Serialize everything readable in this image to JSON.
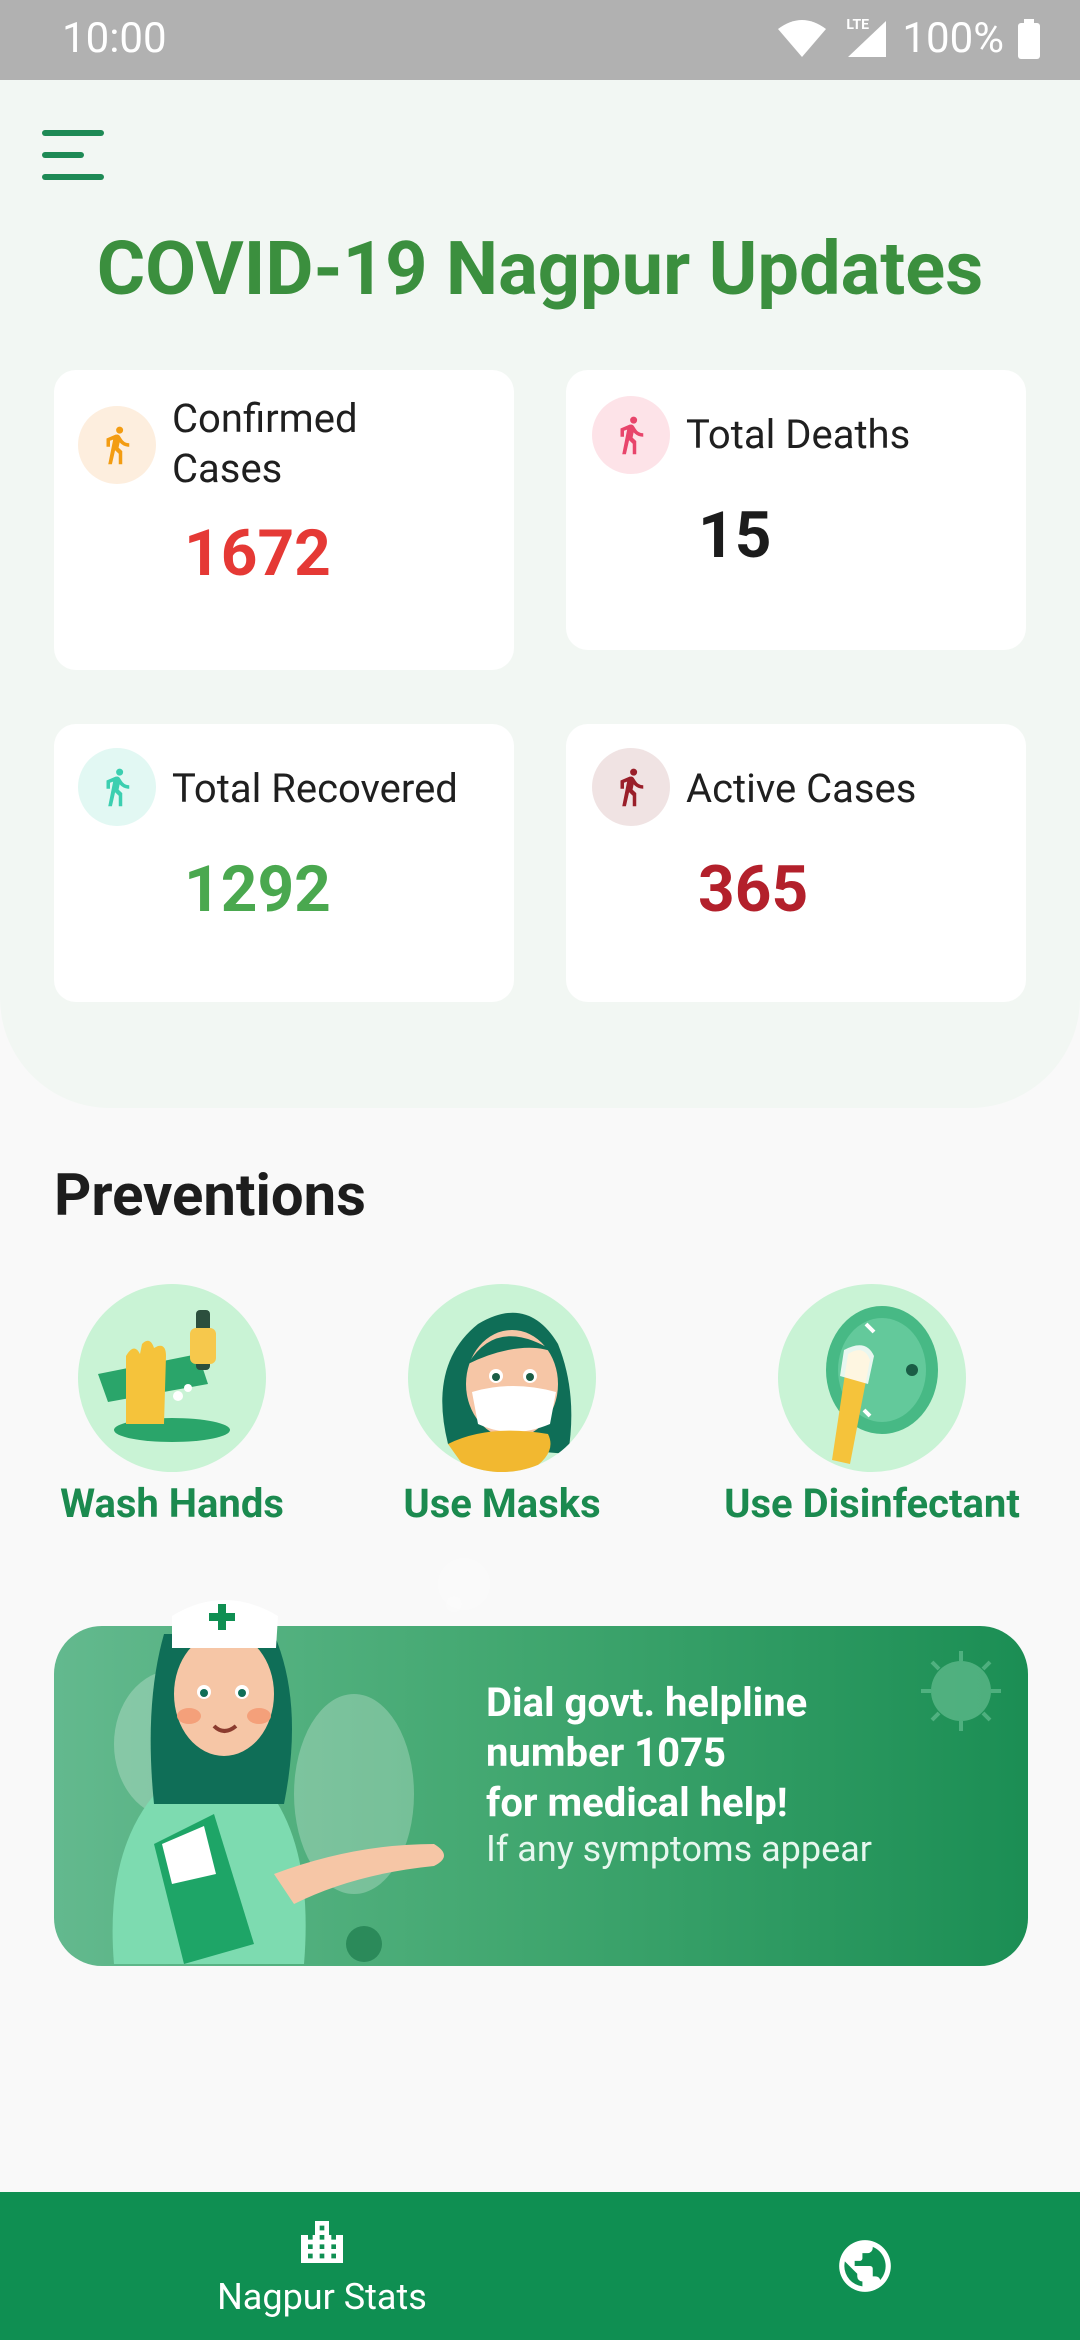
{
  "status_bar": {
    "time": "10:00",
    "network": "LTE",
    "battery": "100%"
  },
  "header": {
    "title": "COVID-19 Nagpur Updates"
  },
  "stats": [
    {
      "label": "Confirmed Cases",
      "value": "1672",
      "color": "#e53935",
      "icon": "running-person-icon",
      "icon_bg": "#fdeede",
      "icon_color": "#f39c12"
    },
    {
      "label": "Total Deaths",
      "value": "15",
      "color": "#1c1c1c",
      "icon": "running-person-icon",
      "icon_bg": "#fde3e8",
      "icon_color": "#e8456b"
    },
    {
      "label": "Total Recovered",
      "value": "1292",
      "color": "#4aa84f",
      "icon": "running-person-icon",
      "icon_bg": "#e2f8f3",
      "icon_color": "#3ccfb0"
    },
    {
      "label": "Active Cases",
      "value": "365",
      "color": "#b3202b",
      "icon": "running-person-icon",
      "icon_bg": "#f0e3e3",
      "icon_color": "#9a1f2a"
    }
  ],
  "preventions": {
    "title": "Preventions",
    "items": [
      {
        "label": "Wash Hands"
      },
      {
        "label": "Use Masks"
      },
      {
        "label": "Use Disinfectant"
      }
    ]
  },
  "banner": {
    "line1": "Dial govt. helpline",
    "line2": "number 1075",
    "line3": "for medical help!",
    "subtitle": "If any symptoms appear"
  },
  "bottom_nav": {
    "item1_label": "Nagpur Stats"
  },
  "colors": {
    "accent": "#0f8f52",
    "title": "#3b8f3e"
  }
}
